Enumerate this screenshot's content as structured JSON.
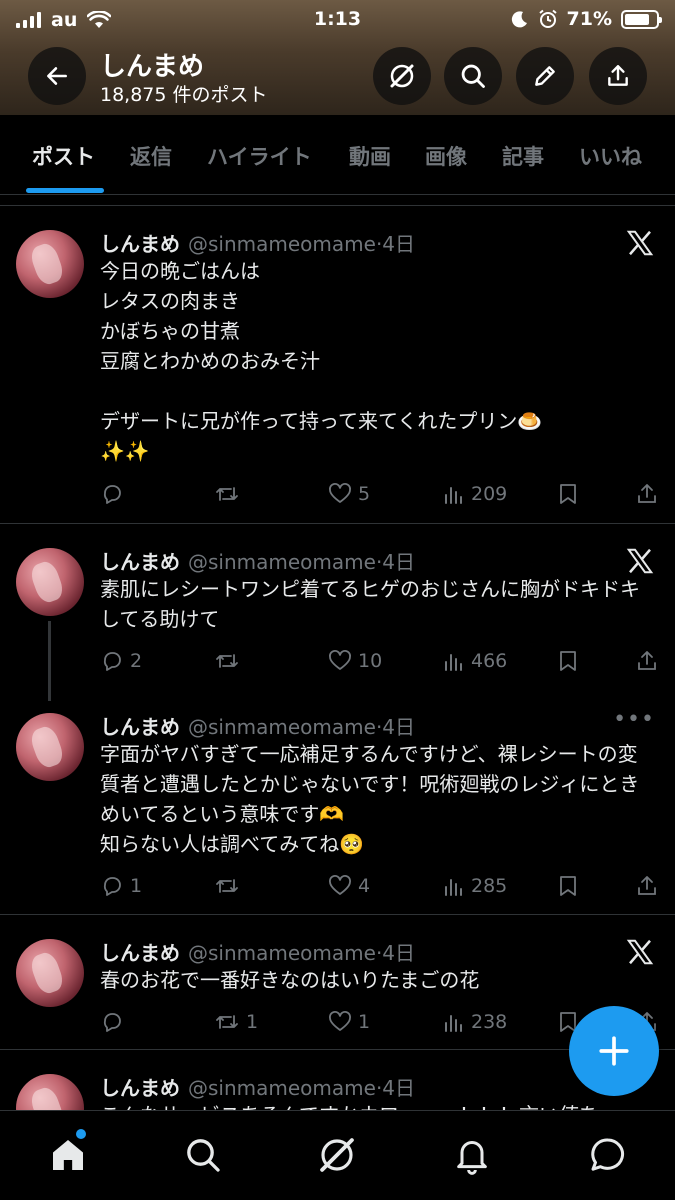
{
  "status_bar": {
    "carrier": "au",
    "time": "1:13",
    "battery": "71%"
  },
  "profile": {
    "name": "しんまめ",
    "post_count": "18,875 件のポスト"
  },
  "tabs": [
    {
      "label": "ポスト",
      "active": true
    },
    {
      "label": "返信"
    },
    {
      "label": "ハイライト"
    },
    {
      "label": "動画"
    },
    {
      "label": "画像"
    },
    {
      "label": "記事"
    },
    {
      "label": "いいね"
    }
  ],
  "posts": [
    {
      "name": "しんまめ",
      "handle": "@sinmameomame",
      "time": "·4日",
      "text": "今日の晩ごはんは\nレタスの肉まき\nかぼちゃの甘煮\n豆腐とわかめのおみそ汁\n\nデザートに兄が作って持って来てくれたプリン🍮\n✨✨",
      "replies": "",
      "reposts": "",
      "likes": "5",
      "views": "209"
    },
    {
      "name": "しんまめ",
      "handle": "@sinmameomame",
      "time": "·4日",
      "text": "素肌にレシートワンピ着てるヒゲのおじさんに胸がドキドキしてる助けて",
      "replies": "2",
      "reposts": "",
      "likes": "10",
      "views": "466"
    },
    {
      "name": "しんまめ",
      "handle": "@sinmameomame",
      "time": "·4日",
      "text": "字面がヤバすぎて一応補足するんですけど、裸レシートの変質者と遭遇したとかじゃないです！呪術廻戦のレジィにときめいてるという意味です🫶\n知らない人は調べてみてね🥺",
      "replies": "1",
      "reposts": "",
      "likes": "4",
      "views": "285"
    },
    {
      "name": "しんまめ",
      "handle": "@sinmameomame",
      "time": "·4日",
      "text": "春のお花で一番好きなのはいりたまごの花",
      "replies": "",
      "reposts": "1",
      "likes": "1",
      "views": "238"
    },
    {
      "name": "しんまめ",
      "handle": "@sinmameomame",
      "time": "·4日",
      "text": "こんなサービスあるんですかウワーーー！！！言い値を"
    }
  ],
  "icons": {
    "back": "back-arrow-icon",
    "grok": "grok-icon",
    "search": "search-icon",
    "edit": "pencil-icon",
    "share": "share-icon",
    "compose": "plus-icon"
  },
  "colors": {
    "accent": "#1d9bf0",
    "muted": "#71767b",
    "text": "#e7e9ea"
  }
}
